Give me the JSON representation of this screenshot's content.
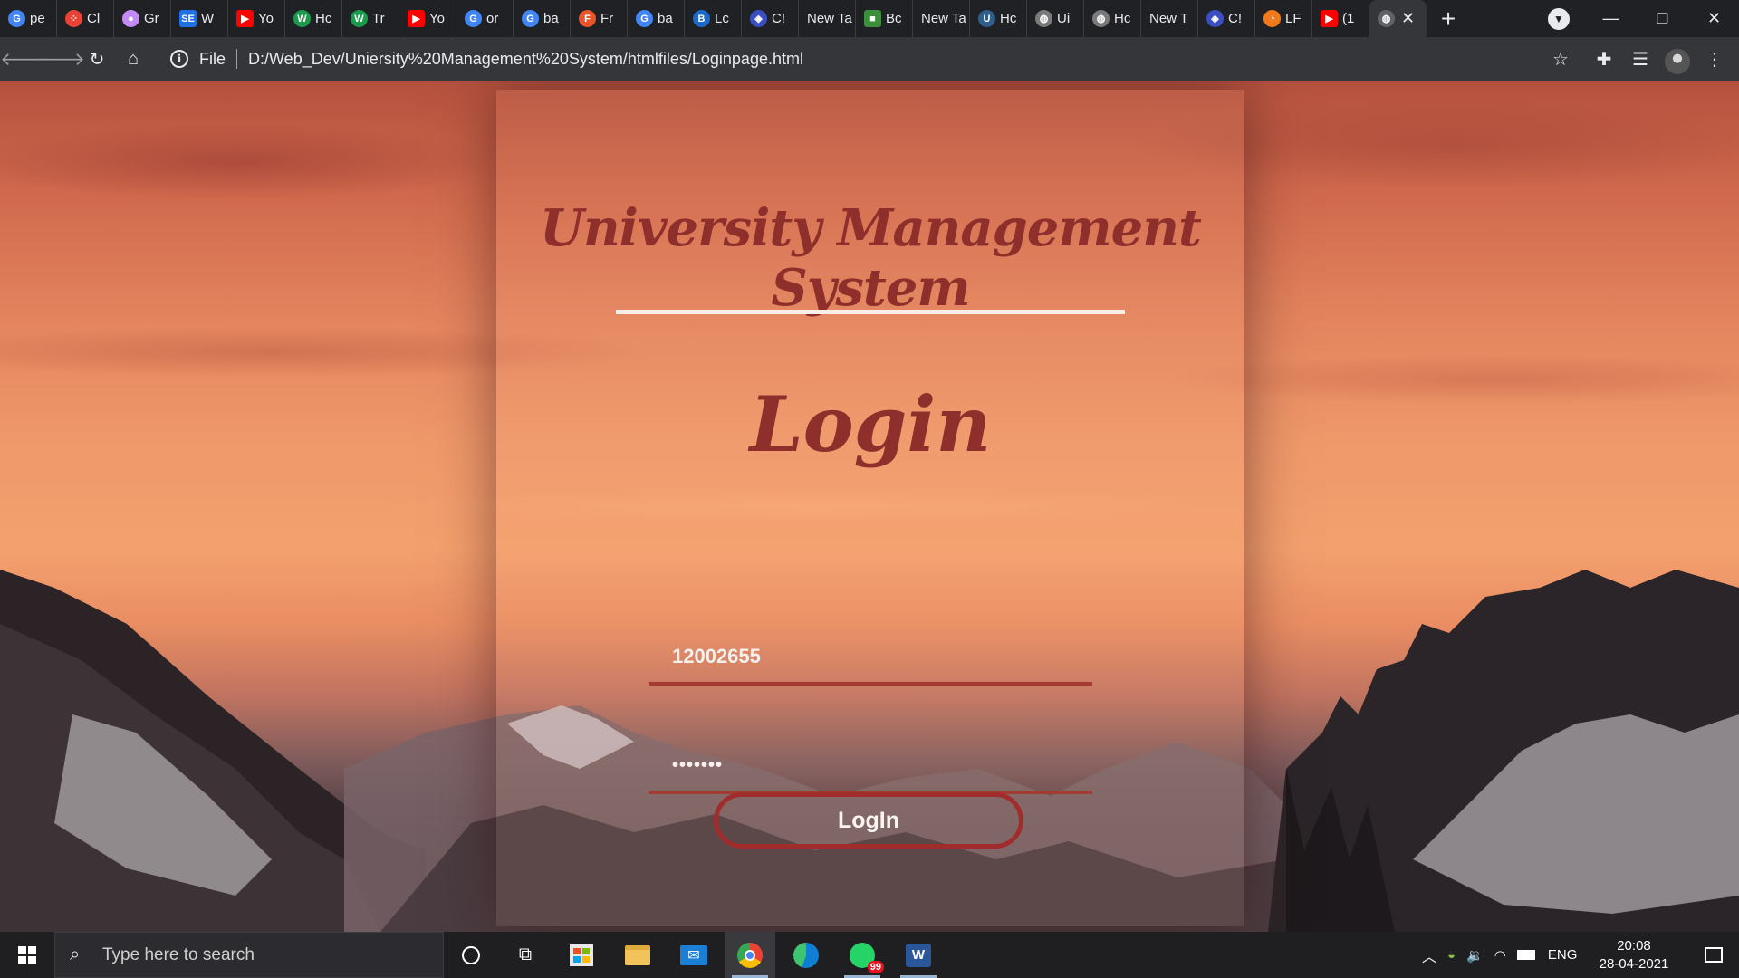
{
  "browser": {
    "tabs": [
      {
        "label": "pe",
        "icon": "google-icon",
        "color": "#4285f4"
      },
      {
        "label": "Cl",
        "icon": "dots-icon",
        "color": "#ea4335"
      },
      {
        "label": "Gr",
        "icon": "circle-icon",
        "color": "#c58af9"
      },
      {
        "label": "W",
        "icon": "se-icon",
        "color": "#1f6feb"
      },
      {
        "label": "Yo",
        "icon": "youtube-icon",
        "color": "#ff0000"
      },
      {
        "label": "Hc",
        "icon": "w-icon",
        "color": "#1a9a4a"
      },
      {
        "label": "Tr",
        "icon": "w-icon",
        "color": "#1a9a4a"
      },
      {
        "label": "Yo",
        "icon": "youtube-icon",
        "color": "#ff0000"
      },
      {
        "label": "or",
        "icon": "google-icon",
        "color": "#4285f4"
      },
      {
        "label": "ba",
        "icon": "google-icon",
        "color": "#4285f4"
      },
      {
        "label": "Fr",
        "icon": "fr-icon",
        "color": "#e8552a"
      },
      {
        "label": "ba",
        "icon": "google-icon",
        "color": "#4285f4"
      },
      {
        "label": "Lc",
        "icon": "xb-icon",
        "color": "#1b6ac9"
      },
      {
        "label": "C!",
        "icon": "shield-icon",
        "color": "#3b4ec2"
      },
      {
        "label": "New Ta",
        "icon": "none",
        "color": ""
      },
      {
        "label": "Bc",
        "icon": "square-icon",
        "color": "#3c8f3c"
      },
      {
        "label": "New Ta",
        "icon": "none",
        "color": ""
      },
      {
        "label": "Hc",
        "icon": "ub-icon",
        "color": "#2d5f8a"
      },
      {
        "label": "Ui",
        "icon": "globe-icon",
        "color": "#7a7a7a"
      },
      {
        "label": "Hc",
        "icon": "globe-icon",
        "color": "#7a7a7a"
      },
      {
        "label": "New T",
        "icon": "none",
        "color": ""
      },
      {
        "label": "C!",
        "icon": "shield-icon",
        "color": "#3b4ec2"
      },
      {
        "label": "LF",
        "icon": "lf-icon",
        "color": "#f07a1a"
      },
      {
        "label": "(1",
        "icon": "youtube-icon",
        "color": "#ff0000"
      }
    ],
    "url_scheme": "File",
    "url": "D:/Web_Dev/Uniersity%20Management%20System/htmlfiles/Loginpage.html"
  },
  "page": {
    "title": "University Management System",
    "heading": "Login",
    "username_value": "12002655",
    "password_value": "•••••••",
    "login_button": "LogIn"
  },
  "taskbar": {
    "search_placeholder": "Type here to search",
    "whatsapp_badge": "99",
    "language": "ENG",
    "time": "20:08",
    "date": "28-04-2021"
  }
}
